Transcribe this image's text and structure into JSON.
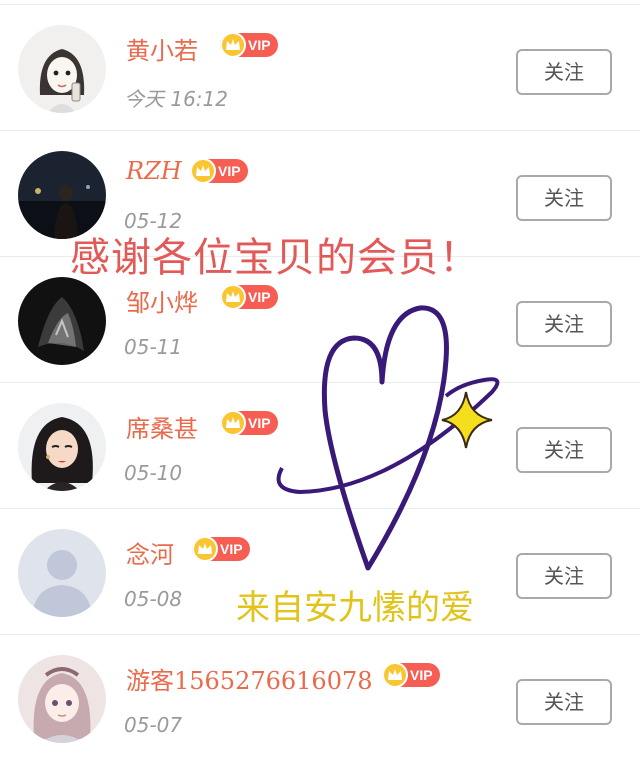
{
  "rows": [
    {
      "name": "黄小若",
      "vip": "VIP",
      "date": "今天 16:12",
      "follow": "关注",
      "avatar": "cartoon-girl-avatar"
    },
    {
      "name": "RZH",
      "vip": "VIP",
      "date": "05-12",
      "follow": "关注",
      "avatar": "night-photo-avatar"
    },
    {
      "name": "邹小烨",
      "vip": "VIP",
      "date": "05-11",
      "follow": "关注",
      "avatar": "dark-blur-avatar"
    },
    {
      "name": "席桑甚",
      "vip": "VIP",
      "date": "05-10",
      "follow": "关注",
      "avatar": "illustrated-woman-avatar"
    },
    {
      "name": "念河",
      "vip": "VIP",
      "date": "05-08",
      "follow": "关注",
      "avatar": "default-user-avatar"
    },
    {
      "name": "游客1565276616078",
      "vip": "VIP",
      "date": "05-07",
      "follow": "关注",
      "avatar": "anime-girl-avatar"
    }
  ],
  "overlay": {
    "title": "感谢各位宝贝的会员！",
    "subtitle": "来自安九愫的爱"
  },
  "colors": {
    "name": "#ea6a4c",
    "vip_badge": "#f65e54",
    "crown": "#f9c631",
    "title": "#e25a58",
    "subtitle": "#e1c31a",
    "heart": "#3a1a78",
    "sparkle": "#f5de1e"
  }
}
